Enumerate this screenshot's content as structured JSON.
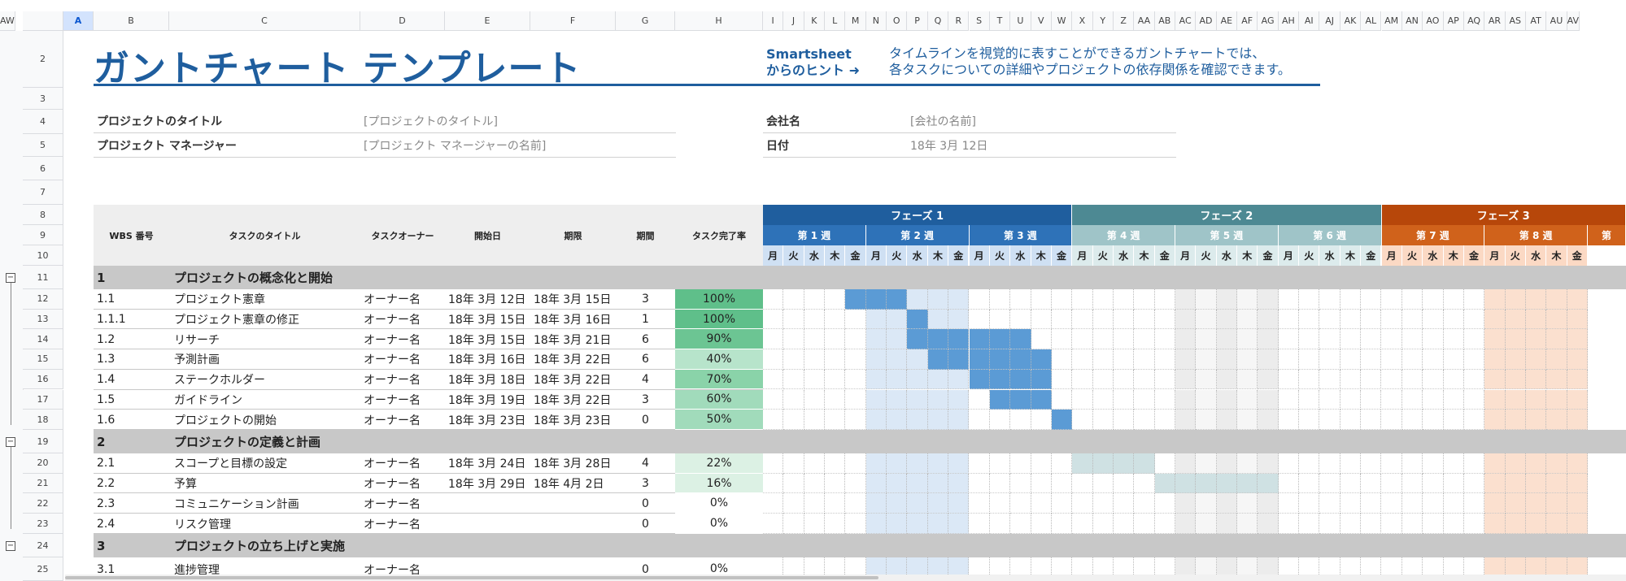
{
  "header": {
    "title": "ガントチャート テンプレート",
    "hint_label_1": "Smartsheet",
    "hint_label_2": "からのヒント ➜",
    "hint_text_1": "タイムラインを視覚的に表すことができるガントチャートでは、",
    "hint_text_2": "各タスクについての詳細やプロジェクトの依存関係を確認できます。"
  },
  "meta": {
    "project_title_label": "プロジェクトのタイトル",
    "project_title_value": "[プロジェクトのタイトル]",
    "manager_label": "プロジェクト マネージャー",
    "manager_value": "[プロジェクト マネージャーの名前]",
    "company_label": "会社名",
    "company_value": "[会社の名前]",
    "date_label": "日付",
    "date_value": "18年 3月 12日"
  },
  "columns": [
    "A",
    "B",
    "C",
    "D",
    "E",
    "F",
    "G",
    "H",
    "I",
    "J",
    "K",
    "L",
    "M",
    "N",
    "O",
    "P",
    "Q",
    "R",
    "S",
    "T",
    "U",
    "V",
    "W",
    "X",
    "Y",
    "Z",
    "AA",
    "AB",
    "AC",
    "AD",
    "AE",
    "AF",
    "AG",
    "AH",
    "AI",
    "AJ",
    "AK",
    "AL",
    "AM",
    "AN",
    "AO",
    "AP",
    "AQ",
    "AR",
    "AS",
    "AT",
    "AU",
    "AV",
    "AW"
  ],
  "selected_column": "A",
  "row_numbers": [
    "2",
    "3",
    "4",
    "5",
    "6",
    "7",
    "8",
    "9",
    "10",
    "11",
    "12",
    "13",
    "14",
    "15",
    "16",
    "17",
    "18",
    "19",
    "20",
    "21",
    "22",
    "23",
    "24",
    "25"
  ],
  "table_headers": {
    "wbs": "WBS 番号",
    "task": "タスクのタイトル",
    "owner": "タスクオーナー",
    "start": "開始日",
    "due": "期限",
    "duration": "期間",
    "pct": "タスク完了率"
  },
  "phases": [
    {
      "label": "フェーズ 1",
      "color": "#1f5e9e"
    },
    {
      "label": "フェーズ 2",
      "color": "#4d8993"
    },
    {
      "label": "フェーズ 3",
      "color": "#b7470a"
    }
  ],
  "weeks": [
    {
      "label": "第 1 週",
      "color": "#2e72b8"
    },
    {
      "label": "第 2 週",
      "color": "#2e72b8"
    },
    {
      "label": "第 3 週",
      "color": "#2e72b8"
    },
    {
      "label": "第 4 週",
      "color": "#9fc4c8"
    },
    {
      "label": "第 5 週",
      "color": "#9fc4c8"
    },
    {
      "label": "第 6 週",
      "color": "#9fc4c8"
    },
    {
      "label": "第 7 週",
      "color": "#d0621b"
    },
    {
      "label": "第 8 週",
      "color": "#d0621b"
    },
    {
      "label": "第",
      "color": "#d0621b"
    }
  ],
  "days": [
    "月",
    "火",
    "水",
    "木",
    "金"
  ],
  "groups": [
    {
      "num": "1",
      "title": "プロジェクトの概念化と開始"
    },
    {
      "num": "2",
      "title": "プロジェクトの定義と計画"
    },
    {
      "num": "3",
      "title": "プロジェクトの立ち上げと実施"
    }
  ],
  "tasks": [
    {
      "wbs": "1.1",
      "title": "プロジェクト憲章",
      "owner": "オーナー名",
      "start": "18年 3月 12日",
      "due": "18年 3月 15日",
      "duration": "3",
      "pct": "100%",
      "pct_value": 100,
      "bar_start": 4,
      "bar_len": 3,
      "bar_color": "#5b9bd5"
    },
    {
      "wbs": "1.1.1",
      "title": "プロジェクト憲章の修正",
      "owner": "オーナー名",
      "start": "18年 3月 15日",
      "due": "18年 3月 16日",
      "duration": "1",
      "pct": "100%",
      "pct_value": 100,
      "bar_start": 7,
      "bar_len": 1,
      "bar_color": "#5b9bd5"
    },
    {
      "wbs": "1.2",
      "title": "リサーチ",
      "owner": "オーナー名",
      "start": "18年 3月 15日",
      "due": "18年 3月 21日",
      "duration": "6",
      "pct": "90%",
      "pct_value": 90,
      "bar_start": 7,
      "bar_len": 6,
      "bar_color": "#5b9bd5"
    },
    {
      "wbs": "1.3",
      "title": "予測計画",
      "owner": "オーナー名",
      "start": "18年 3月 16日",
      "due": "18年 3月 22日",
      "duration": "6",
      "pct": "40%",
      "pct_value": 40,
      "bar_start": 8,
      "bar_len": 6,
      "bar_color": "#5b9bd5"
    },
    {
      "wbs": "1.4",
      "title": "ステークホルダー",
      "owner": "オーナー名",
      "start": "18年 3月 18日",
      "due": "18年 3月 22日",
      "duration": "4",
      "pct": "70%",
      "pct_value": 70,
      "bar_start": 10,
      "bar_len": 4,
      "bar_color": "#5b9bd5"
    },
    {
      "wbs": "1.5",
      "title": "ガイドライン",
      "owner": "オーナー名",
      "start": "18年 3月 19日",
      "due": "18年 3月 22日",
      "duration": "3",
      "pct": "60%",
      "pct_value": 60,
      "bar_start": 11,
      "bar_len": 3,
      "bar_color": "#5b9bd5"
    },
    {
      "wbs": "1.6",
      "title": "プロジェクトの開始",
      "owner": "オーナー名",
      "start": "18年 3月 23日",
      "due": "18年 3月 23日",
      "duration": "0",
      "pct": "50%",
      "pct_value": 50,
      "bar_start": 14,
      "bar_len": 1,
      "bar_color": "#5b9bd5"
    },
    {
      "wbs": "2.1",
      "title": "スコープと目標の設定",
      "owner": "オーナー名",
      "start": "18年 3月 24日",
      "due": "18年 3月 28日",
      "duration": "4",
      "pct": "22%",
      "pct_value": 22,
      "bar_start": 15,
      "bar_len": 4,
      "bar_color": "#cfe1e3"
    },
    {
      "wbs": "2.2",
      "title": "予算",
      "owner": "オーナー名",
      "start": "18年 3月 29日",
      "due": "18年 4月 2日",
      "duration": "3",
      "pct": "16%",
      "pct_value": 16,
      "bar_start": 19,
      "bar_len": 6,
      "bar_color": "#cfe1e3"
    },
    {
      "wbs": "2.3",
      "title": "コミュニケーション計画",
      "owner": "オーナー名",
      "start": "",
      "due": "",
      "duration": "0",
      "pct": "0%",
      "pct_value": 0,
      "bar_start": 0,
      "bar_len": 0,
      "bar_color": "#cfe1e3"
    },
    {
      "wbs": "2.4",
      "title": "リスク管理",
      "owner": "オーナー名",
      "start": "",
      "due": "",
      "duration": "0",
      "pct": "0%",
      "pct_value": 0,
      "bar_start": 0,
      "bar_len": 0,
      "bar_color": "#cfe1e3"
    },
    {
      "wbs": "3.1",
      "title": "進捗管理",
      "owner": "オーナー名",
      "start": "",
      "due": "",
      "duration": "0",
      "pct": "0%",
      "pct_value": 0,
      "bar_start": 0,
      "bar_len": 0,
      "bar_color": "#fbe0cf"
    }
  ],
  "colors": {
    "table_header_bg": "#eeeeee",
    "group_row_bg": "#c8c8c8",
    "pct_full": "#5fbf8a",
    "week2_tint": "#dbe8f6",
    "week5_tint": "#ececec",
    "week8_tint": "#fbe0cf",
    "day_header_phase1": "#cfe0f3",
    "day_header_phase2": "#dcebec",
    "day_header_phase3": "#fbd9c4"
  }
}
